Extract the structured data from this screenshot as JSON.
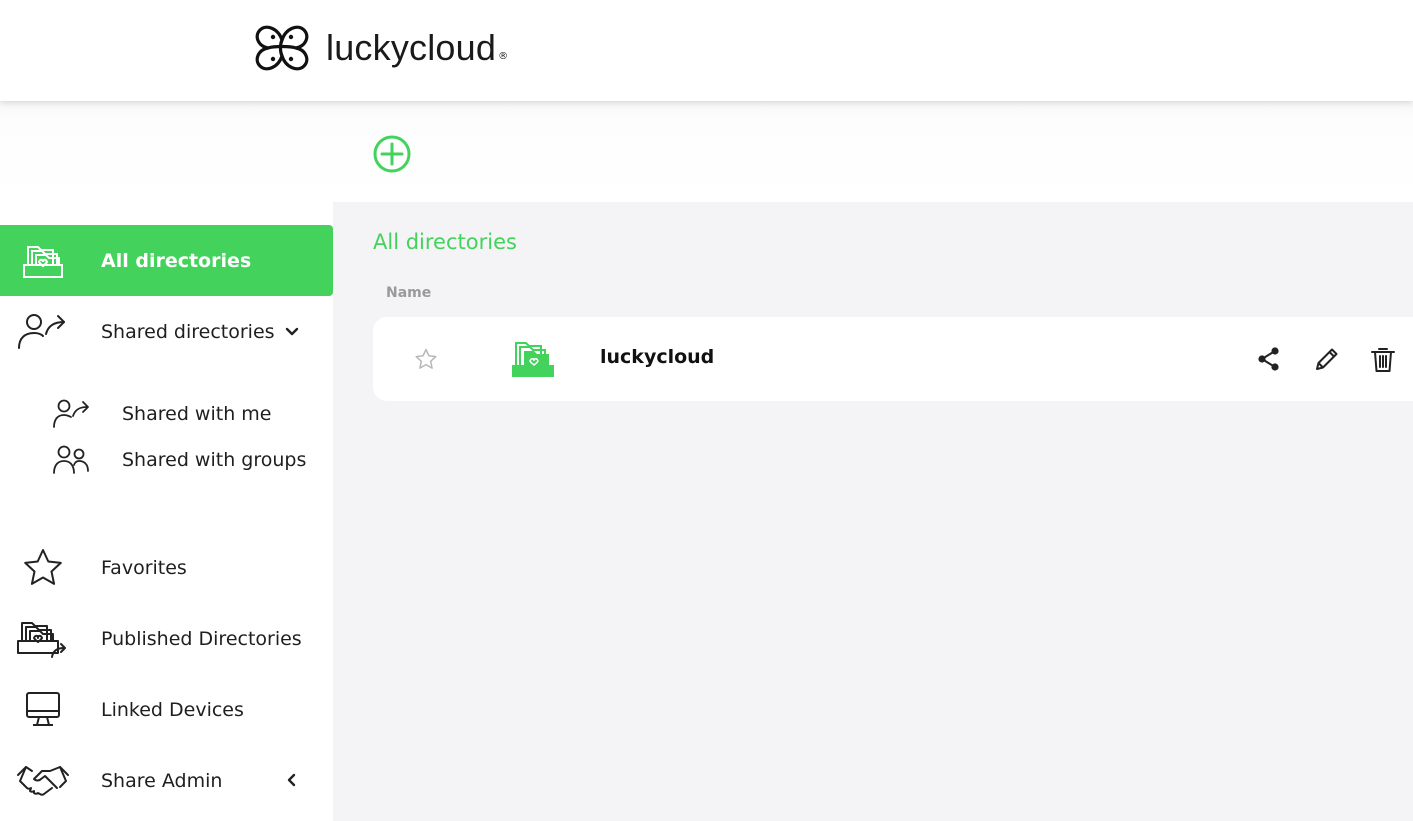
{
  "brand": {
    "name": "luckycloud",
    "reg": "®"
  },
  "colors": {
    "accent": "#43d35c",
    "main_bg": "#f4f4f6",
    "text": "#1f1f1f"
  },
  "toolbar": {
    "add_icon": "plus-circle-icon"
  },
  "sidebar": {
    "all_directories": "All directories",
    "shared_directories": "Shared directories",
    "shared_with_me": "Shared with me",
    "shared_with_groups": "Shared with groups",
    "favorites": "Favorites",
    "published_directories": "Published Directories",
    "linked_devices": "Linked Devices",
    "share_admin": "Share Admin"
  },
  "main": {
    "title": "All directories",
    "column_name": "Name",
    "rows": [
      {
        "name": "luckycloud",
        "icons": [
          "star-icon",
          "folder-icon",
          "share-icon",
          "pencil-icon",
          "trash-icon"
        ]
      }
    ]
  }
}
